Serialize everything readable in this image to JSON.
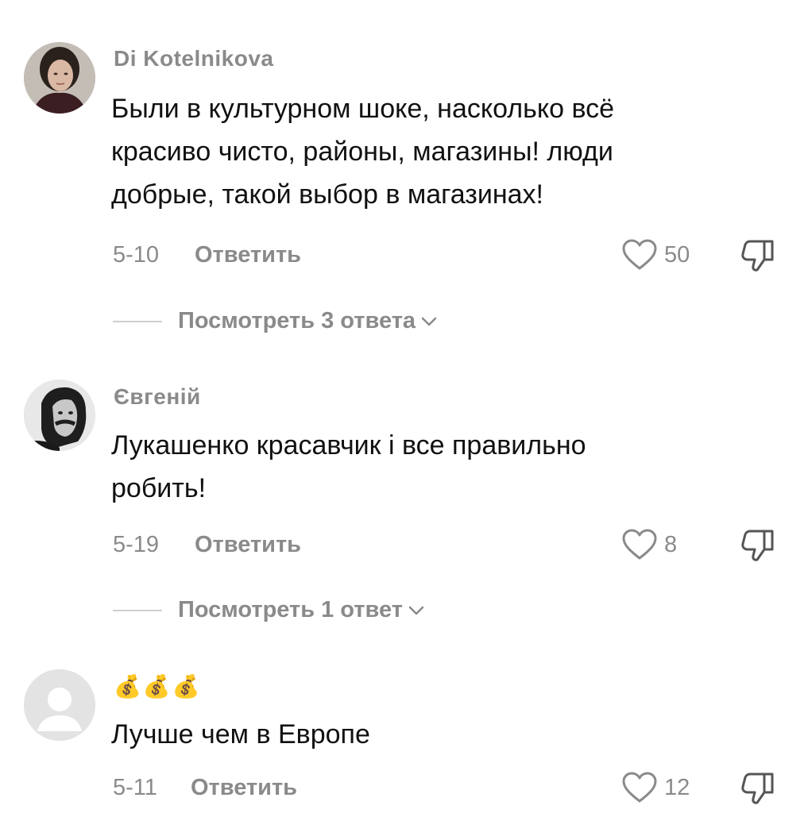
{
  "comments": [
    {
      "username": "Di Kotelnikova",
      "text_lines": [
        "Были в культурном шоке, насколько всё",
        "красиво чисто, районы, магазины! люди",
        "добрые, такой выбор в магазинах!"
      ],
      "date": "5-10",
      "reply_label": "Ответить",
      "likes": "50",
      "view_replies": "Посмотреть 3 ответа"
    },
    {
      "username": "Євгеній",
      "text_lines": [
        "Лукашенко красавчик і все правильно",
        "робить!"
      ],
      "date": "5-19",
      "reply_label": "Ответить",
      "likes": "8",
      "view_replies": "Посмотреть 1 ответ"
    },
    {
      "username": "💰💰💰",
      "text_lines": [
        "Лучше чем в Европе"
      ],
      "date": "5-11",
      "reply_label": "Ответить",
      "likes": "12"
    }
  ],
  "icons": {
    "like": "heart-outline-icon",
    "dislike": "thumbs-down-outline-icon",
    "expand": "chevron-down-icon"
  },
  "colors": {
    "text_primary": "#111111",
    "text_secondary": "#8a8a8a",
    "divider": "#cfcfcf"
  }
}
